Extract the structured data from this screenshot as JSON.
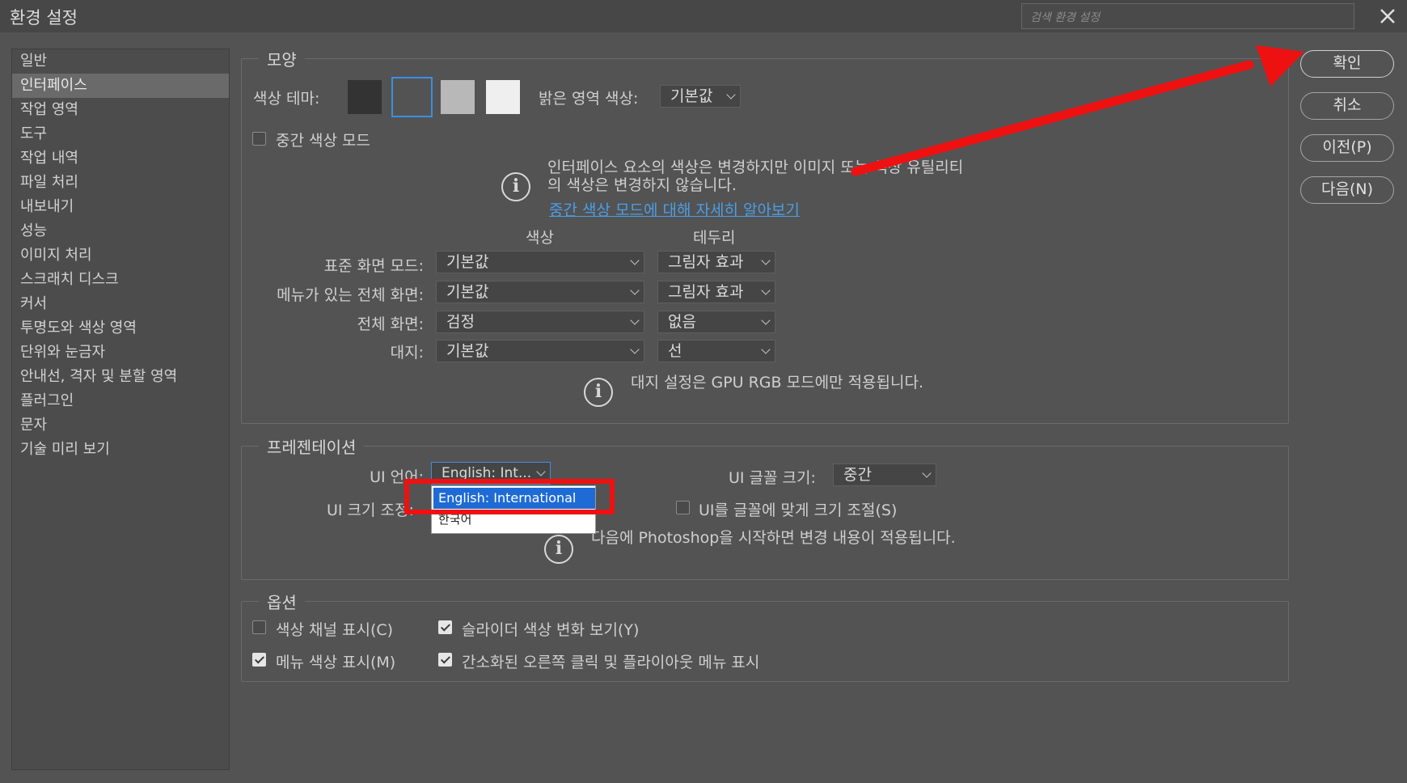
{
  "window": {
    "title": "환경 설정",
    "search_placeholder": "검색 환경 설정"
  },
  "sidebar": {
    "items": [
      {
        "label": "일반"
      },
      {
        "label": "인터페이스"
      },
      {
        "label": "작업 영역"
      },
      {
        "label": "도구"
      },
      {
        "label": "작업 내역"
      },
      {
        "label": "파일 처리"
      },
      {
        "label": "내보내기"
      },
      {
        "label": "성능"
      },
      {
        "label": "이미지 처리"
      },
      {
        "label": "스크래치 디스크"
      },
      {
        "label": "커서"
      },
      {
        "label": "투명도와 색상 영역"
      },
      {
        "label": "단위와 눈금자"
      },
      {
        "label": "안내선, 격자 및 분할 영역"
      },
      {
        "label": "플러그인"
      },
      {
        "label": "문자"
      },
      {
        "label": "기술 미리 보기"
      }
    ],
    "selected": "인터페이스"
  },
  "appearance": {
    "legend": "모양",
    "color_theme_label": "색상 테마:",
    "themes": [
      "#333333",
      "#535353",
      "#b8b8b8",
      "#efefef"
    ],
    "selected_theme": 1,
    "highlight_label": "밝은 영역 색상:",
    "highlight_value": "기본값",
    "mid_color_mode": "중간 색상 모드",
    "mid_info_line1": "인터페이스 요소의 색상은 변경하지만 이미지 또는 색상 유틸리티",
    "mid_info_line2": "의 색상은 변경하지 않습니다.",
    "mid_info_link": "중간 색상 모드에 대해 자세히 알아보기",
    "col_color": "색상",
    "col_border": "테두리",
    "rows": [
      {
        "label": "표준 화면 모드:",
        "color": "기본값",
        "border": "그림자 효과"
      },
      {
        "label": "메뉴가 있는 전체 화면:",
        "color": "기본값",
        "border": "그림자 효과"
      },
      {
        "label": "전체 화면:",
        "color": "검정",
        "border": "없음"
      },
      {
        "label": "대지:",
        "color": "기본값",
        "border": "선"
      }
    ],
    "artboard_note": "대지 설정은 GPU RGB 모드에만 적용됩니다."
  },
  "presentation": {
    "legend": "프레젠테이션",
    "ui_language_label": "UI 언어:",
    "ui_language_value": "English: Int...",
    "ui_font_size_label": "UI 글꼴 크기:",
    "ui_font_size_value": "중간",
    "ui_scale_label": "UI 크기 조정:",
    "scale_to_font": "UI를 글꼴에 맞게 크기 조절(S)",
    "restart_note": "다음에 Photoshop을 시작하면 변경 내용이 적용됩니다.",
    "language_options": [
      "English: International",
      "한국어"
    ]
  },
  "options": {
    "legend": "옵션",
    "show_channels_color": {
      "label": "색상 채널 표시(C)",
      "checked": false
    },
    "slider_color_preview": {
      "label": "슬라이더 색상 변화 보기(Y)",
      "checked": true
    },
    "show_menu_colors": {
      "label": "메뉴 색상 표시(M)",
      "checked": true
    },
    "simplified_flyout": {
      "label": "간소화된 오른쪽 클릭 및 플라이아웃 메뉴 표시",
      "checked": true
    }
  },
  "buttons": {
    "ok": "확인",
    "cancel": "취소",
    "prev": "이전(P)",
    "next": "다음(N)"
  },
  "annotation_color": "#ee1111"
}
